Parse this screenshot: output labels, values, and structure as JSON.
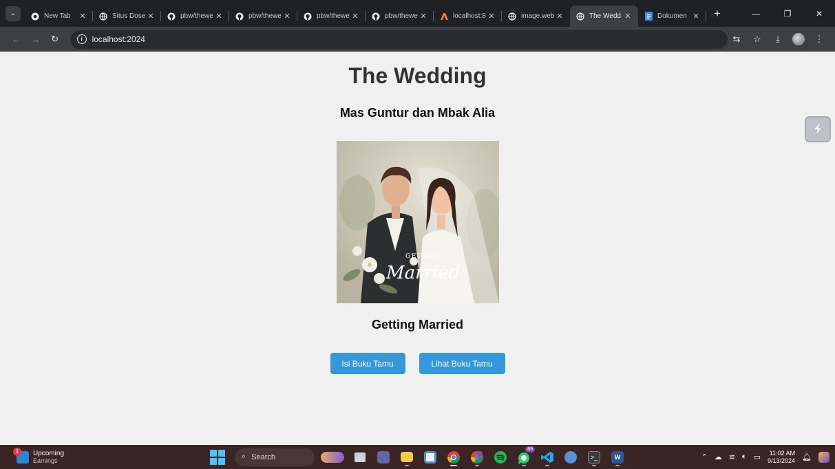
{
  "browser": {
    "tabs": [
      {
        "title": "New Tab",
        "icon": "chrome-icon",
        "active": false
      },
      {
        "title": "Situs Dose",
        "icon": "globe-icon",
        "active": false
      },
      {
        "title": "pbw/thewe",
        "icon": "github-icon",
        "active": false
      },
      {
        "title": "pbw/thewe",
        "icon": "github-icon",
        "active": false
      },
      {
        "title": "pbw/thewe",
        "icon": "github-icon",
        "active": false
      },
      {
        "title": "pbw/thewe",
        "icon": "github-icon",
        "active": false
      },
      {
        "title": "localhost:8",
        "icon": "xampp-icon",
        "active": false
      },
      {
        "title": "image.web",
        "icon": "globe-icon",
        "active": false
      },
      {
        "title": "The Wedd",
        "icon": "globe-icon",
        "active": true
      },
      {
        "title": "Dokumen",
        "icon": "docs-icon",
        "active": false
      }
    ],
    "address": "localhost:2024"
  },
  "page": {
    "title": "The Wedding",
    "subtitle": "Mas Guntur dan Mbak Alia",
    "photo_text_top": "GETTING",
    "photo_text_script": "Married",
    "caption": "Getting Married",
    "buttons": {
      "guestbook_fill": "Isi Buku Tamu",
      "guestbook_view": "Lihat Buku Tamu"
    }
  },
  "taskbar": {
    "widget_title": "Upcoming",
    "widget_subtitle": "Earnings",
    "widget_badge": "1",
    "search_placeholder": "Search",
    "whatsapp_badge": "89",
    "time": "11:02 AM",
    "date": "9/13/2024"
  },
  "colors": {
    "accent_button": "#3498db",
    "page_bg": "#f0f0f0",
    "taskbar_bg": "#3a2424"
  }
}
